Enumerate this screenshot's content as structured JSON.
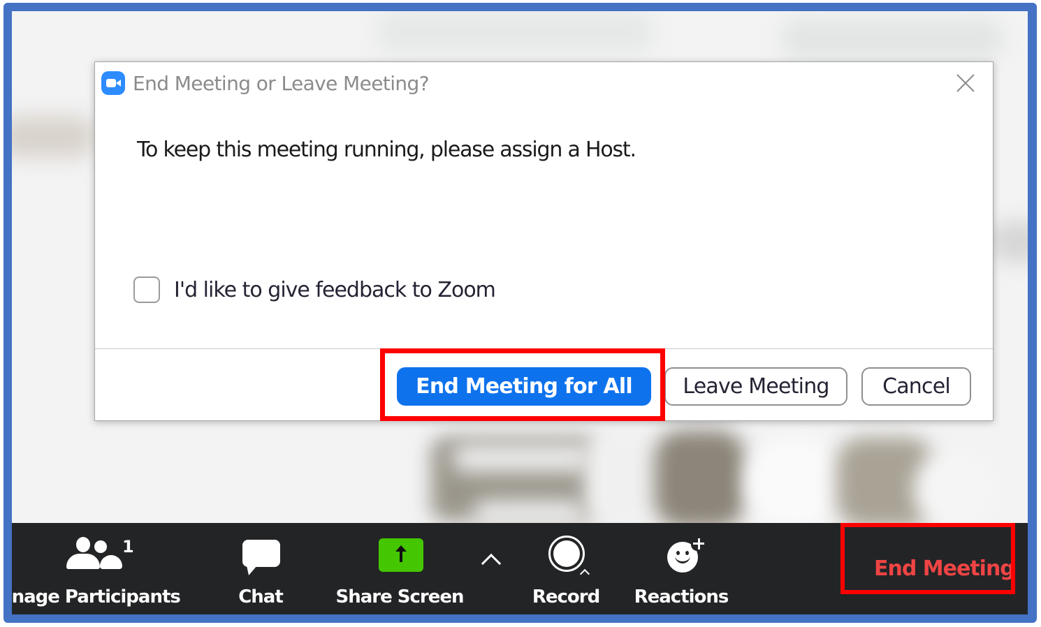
{
  "dialog": {
    "title": "End Meeting or Leave Meeting?",
    "app_icon": "zoom-video-camera-icon",
    "close_icon": "close-icon",
    "message": "To keep this meeting running, please assign a Host.",
    "feedback_checkbox": {
      "label": "I'd like to give feedback to Zoom",
      "checked": false
    },
    "buttons": {
      "end_for_all": "End Meeting for All",
      "leave": "Leave Meeting",
      "cancel": "Cancel"
    }
  },
  "toolbar": {
    "items": [
      {
        "label": "lanage Participants",
        "icon": "participants-icon",
        "badge": "1"
      },
      {
        "label": "Chat",
        "icon": "chat-icon"
      },
      {
        "label": "Share Screen",
        "icon": "share-screen-icon"
      },
      {
        "label": "Record",
        "icon": "record-icon"
      },
      {
        "label": "Reactions",
        "icon": "reactions-icon"
      }
    ],
    "more_options_icon": "chevron-up-icon",
    "end_meeting_label": "End Meeting"
  },
  "colors": {
    "frame_blue": "#4472c4",
    "primary_button": "#0e72ed",
    "share_green": "#44c600",
    "end_meeting_red": "#ef4444",
    "highlight_red": "#ff0000",
    "toolbar_bg": "#232426"
  },
  "annotations": {
    "highlighted": [
      "End Meeting for All",
      "End Meeting"
    ]
  }
}
